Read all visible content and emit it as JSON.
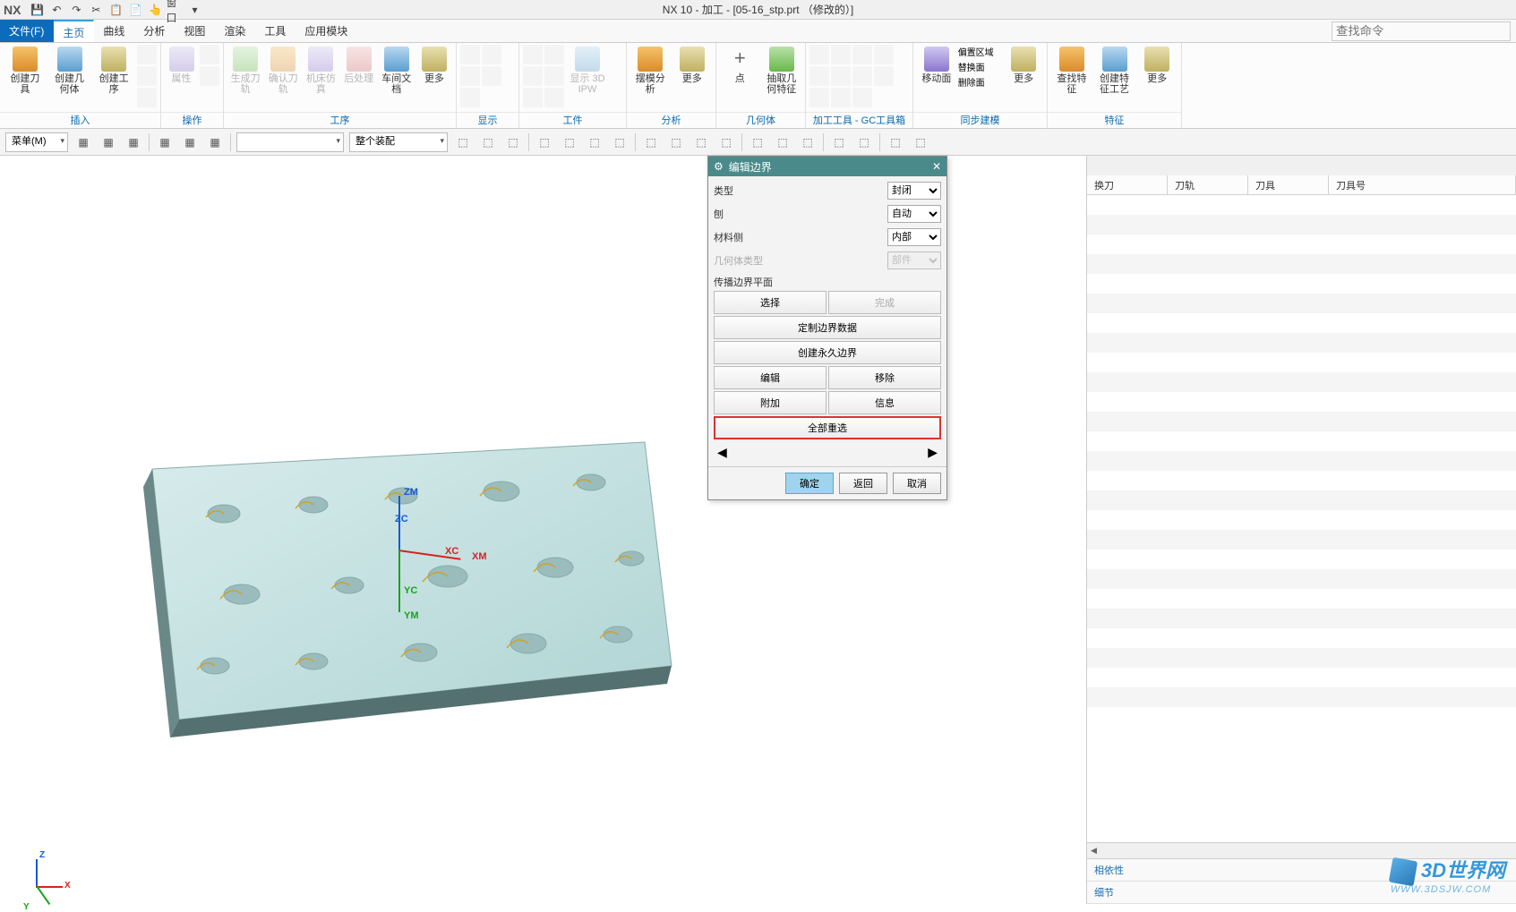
{
  "title": "NX 10 - 加工 - [05-16_stp.prt （修改的）]",
  "titlebar": {
    "window_menu": "窗口"
  },
  "menu": {
    "file": "文件(F)",
    "items": [
      "主页",
      "曲线",
      "分析",
      "视图",
      "渲染",
      "工具",
      "应用模块"
    ],
    "active": 0,
    "search_placeholder": "查找命令"
  },
  "ribbon": {
    "groups": [
      {
        "label": "插入",
        "buttons": [
          {
            "label": "创建刀具",
            "icon": "c1",
            "disabled": false
          },
          {
            "label": "创建几何体",
            "icon": "c5",
            "disabled": false
          },
          {
            "label": "创建工序",
            "icon": "c6",
            "disabled": false
          }
        ],
        "smallcol": true
      },
      {
        "label": "操作",
        "buttons": [
          {
            "label": "属性",
            "icon": "c3",
            "disabled": true
          }
        ],
        "smallcol": true
      },
      {
        "label": "工序",
        "buttons": [
          {
            "label": "生成刀轨",
            "icon": "c2",
            "disabled": true
          },
          {
            "label": "确认刀轨",
            "icon": "c1",
            "disabled": true
          },
          {
            "label": "机床仿真",
            "icon": "c3",
            "disabled": true
          },
          {
            "label": "后处理",
            "icon": "c4",
            "disabled": true
          },
          {
            "label": "车间文档",
            "icon": "c5",
            "disabled": false
          },
          {
            "label": "更多",
            "icon": "c6",
            "disabled": false
          }
        ]
      },
      {
        "label": "显示",
        "buttons": [],
        "smallcol3": true,
        "sublabel": "显示 3D IPW"
      },
      {
        "label": "工件",
        "buttons": [],
        "smallcol3": true
      },
      {
        "label": "分析",
        "buttons": [
          {
            "label": "摆模分析",
            "icon": "c1",
            "disabled": false
          },
          {
            "label": "更多",
            "icon": "c6",
            "disabled": false
          }
        ]
      },
      {
        "label": "几何体",
        "buttons": [
          {
            "label": "点",
            "icon": "c5",
            "disabled": false
          },
          {
            "label": "抽取几何特征",
            "icon": "c2",
            "disabled": false
          }
        ]
      },
      {
        "label": "加工工具 - GC工具箱",
        "buttons": [],
        "smallcol3": true
      },
      {
        "label": "同步建模",
        "buttons": [
          {
            "label": "移动面",
            "icon": "c3",
            "disabled": false
          }
        ],
        "sidecol": [
          "偏置区域",
          "替换面",
          "删除面"
        ],
        "more": "更多"
      },
      {
        "label": "特征",
        "buttons": [
          {
            "label": "查找特征",
            "icon": "c1",
            "disabled": false
          },
          {
            "label": "创建特征工艺",
            "icon": "c5",
            "disabled": false
          },
          {
            "label": "更多",
            "icon": "c6",
            "disabled": false
          }
        ]
      }
    ]
  },
  "toolbar2": {
    "menu_btn": "菜单(M)",
    "assembly_dd": "整个装配"
  },
  "viewport": {
    "axes": {
      "zm": "ZM",
      "zc": "ZC",
      "xc": "XC",
      "xm": "XM",
      "yc": "YC",
      "ym": "YM"
    },
    "triad": {
      "x": "X",
      "y": "Y",
      "z": "Z"
    }
  },
  "dialog": {
    "title": "编辑边界",
    "rows": [
      {
        "label": "类型",
        "value": "封闭"
      },
      {
        "label": "刨",
        "value": "自动"
      },
      {
        "label": "材料侧",
        "value": "内部"
      },
      {
        "label": "几何体类型",
        "value": "部件",
        "disabled": true
      }
    ],
    "section": "传播边界平面",
    "btns_top": [
      {
        "l": "选择"
      },
      {
        "l": "完成",
        "disabled": true
      }
    ],
    "btns_full": [
      "定制边界数据",
      "创建永久边界"
    ],
    "btns_pair": [
      [
        "编辑",
        "移除"
      ],
      [
        "附加",
        "信息"
      ]
    ],
    "btn_highlight": "全部重选",
    "arrows": {
      "left": "◀",
      "right": "▶"
    },
    "footer": {
      "ok": "确定",
      "back": "返回",
      "cancel": "取消"
    }
  },
  "right": {
    "cols": [
      "换刀",
      "刀轨",
      "刀具",
      "刀具号"
    ],
    "footer": [
      "相依性",
      "细节"
    ]
  },
  "watermark": {
    "text": "3D世界网",
    "url": "WWW.3DSJW.COM"
  }
}
